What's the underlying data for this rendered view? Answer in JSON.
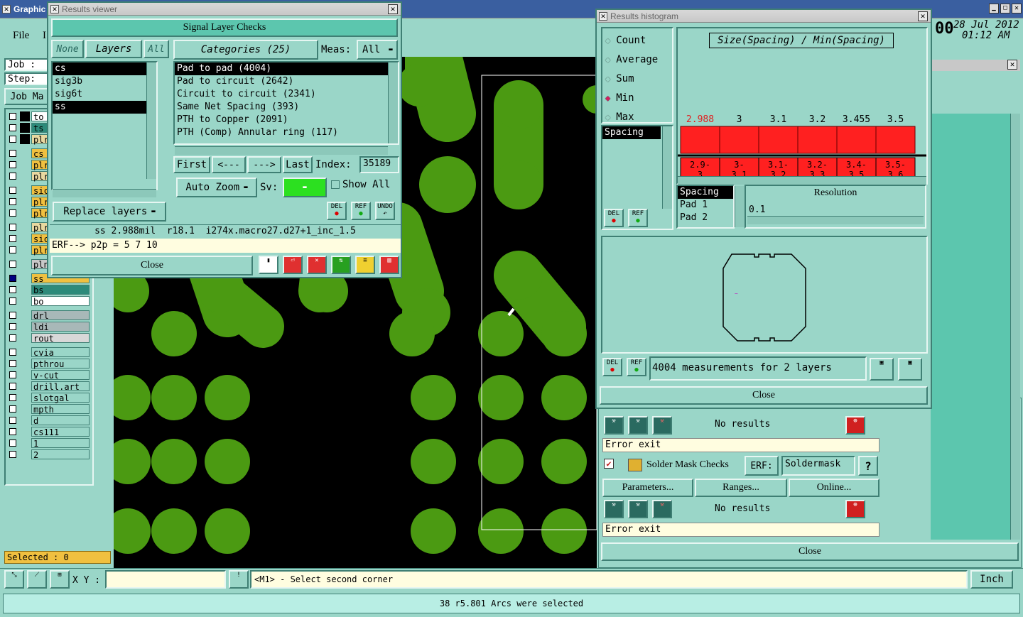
{
  "main": {
    "title": "Graphic",
    "menu_file": "File",
    "menu_l": "I",
    "datetime_date": "28 Jul 2012",
    "datetime_time": "01:12 AM",
    "time_prefix": "00",
    "job_label": "Job :",
    "step_label": "Step:",
    "job_matrix_label": "Job Ma"
  },
  "layers": [
    {
      "name": "to",
      "color": "#ffffff"
    },
    {
      "name": "ts",
      "color": "#2d8a7a"
    },
    {
      "name": "plr",
      "color": "#e8d8a0"
    },
    {
      "name": "cs",
      "color": "#f0c040"
    },
    {
      "name": "plr",
      "color": "#f0c040"
    },
    {
      "name": "plr",
      "color": "#e8d8a0"
    },
    {
      "name": "sic",
      "color": "#f0c040"
    },
    {
      "name": "plr",
      "color": "#f0c040"
    },
    {
      "name": "plr",
      "color": "#f0c040"
    },
    {
      "name": "plr",
      "color": "#e8d8a0"
    },
    {
      "name": "sic",
      "color": "#f0c040"
    },
    {
      "name": "plr",
      "color": "#f0c040"
    },
    {
      "name": "plnss",
      "color": "#c8c8c8"
    },
    {
      "name": "ss",
      "color": "#f0c040"
    },
    {
      "name": "bs",
      "color": "#2d8a7a"
    },
    {
      "name": "bo",
      "color": "#ffffff"
    },
    {
      "name": "drl",
      "color": "#a8b8b8"
    },
    {
      "name": "ldi",
      "color": "#a8b8b8"
    },
    {
      "name": "rout",
      "color": "#d8d8d8"
    },
    {
      "name": "cvia",
      "color": "#9ad6c8"
    },
    {
      "name": "pthrou",
      "color": "#9ad6c8"
    },
    {
      "name": "v-cut",
      "color": "#9ad6c8"
    },
    {
      "name": "drill.art",
      "color": "#9ad6c8"
    },
    {
      "name": "slotgal",
      "color": "#9ad6c8"
    },
    {
      "name": "mpth",
      "color": "#9ad6c8"
    },
    {
      "name": "d",
      "color": "#9ad6c8"
    },
    {
      "name": "cs111",
      "color": "#9ad6c8"
    },
    {
      "name": "1",
      "color": "#9ad6c8"
    },
    {
      "name": "2",
      "color": "#9ad6c8"
    }
  ],
  "selected_label": "Selected : 0",
  "bottom": {
    "xy_label": "X Y :",
    "xy_value": "",
    "prompt": "<M1> - Select second corner",
    "units": "Inch",
    "status": "38 r5.801 Arcs were selected"
  },
  "rv": {
    "title": "Results viewer",
    "header": "Signal Layer Checks",
    "none": "None",
    "layers_tab": "Layers",
    "all": "All",
    "categories": "Categories (25)",
    "meas_label": "Meas:",
    "meas_value": "All",
    "layer_items": [
      "cs",
      "sig3b",
      "sig6t",
      "ss"
    ],
    "cat_items": [
      "Pad to pad (4004)",
      "Pad to circuit (2642)",
      "Circuit to circuit (2341)",
      "Same Net Spacing (393)",
      "PTH to Copper (2091)",
      "PTH (Comp) Annular ring (117)"
    ],
    "first": "First",
    "prev": "<---",
    "next": "--->",
    "last": "Last",
    "index_label": "Index:",
    "index_value": "35189",
    "auto_zoom": "Auto Zoom",
    "sv_label": "Sv:",
    "show_all": "Show All",
    "replace_layers": "Replace layers",
    "del": "DEL",
    "ref": "REF",
    "undo": "UNDO",
    "info": "ss 2.988mil  r18.1  i274x.macro27.d27+1_inc_1.5",
    "erf": "ERF--> p2p = 5 7 10",
    "close": "Close"
  },
  "rh": {
    "title": "Results histogram",
    "radios": [
      "Count",
      "Average",
      "Sum",
      "Min",
      "Max"
    ],
    "radio_selected": "Min",
    "chart_title": "Size(Spacing) / Min(Spacing)",
    "top_list": [
      "Spacing"
    ],
    "layer_list": [
      "Spacing",
      "Pad 1",
      "Pad 2"
    ],
    "resolution_label": "Resolution",
    "resolution_value": "0.1",
    "summary": "4004 measurements for 2 layers",
    "close": "Close",
    "del": "DEL",
    "ref": "REF"
  },
  "chart_data": {
    "type": "bar",
    "title": "Size(Spacing) / Min(Spacing)",
    "categories": [
      "2.9-3",
      "3-3.1",
      "3.1-3.2",
      "3.2-3.3",
      "3.4-3.5",
      "3.5-3.6"
    ],
    "category_labels": [
      [
        "2.9-",
        "3"
      ],
      [
        "3-",
        "3.1"
      ],
      [
        "3.1-",
        "3.2"
      ],
      [
        "3.2-",
        "3.3"
      ],
      [
        "3.4-",
        "3.5"
      ],
      [
        "3.5-",
        "3.6"
      ]
    ],
    "values": [
      2.988,
      3,
      3.1,
      3.2,
      3.455,
      3.5
    ],
    "value_labels": [
      "2.988",
      "3",
      "3.1",
      "3.2",
      "3.455",
      "3.5"
    ],
    "bar_color": "#ff2020",
    "first_label_color": "#e02020"
  },
  "checks": {
    "no_results": "No results",
    "error_exit": "Error exit",
    "solder_mask": "Solder Mask Checks",
    "erf_label": "ERF:",
    "erf_value": "Soldermask",
    "parameters": "Parameters...",
    "ranges": "Ranges...",
    "online": "Online...",
    "close": "Close",
    "help": "?"
  }
}
